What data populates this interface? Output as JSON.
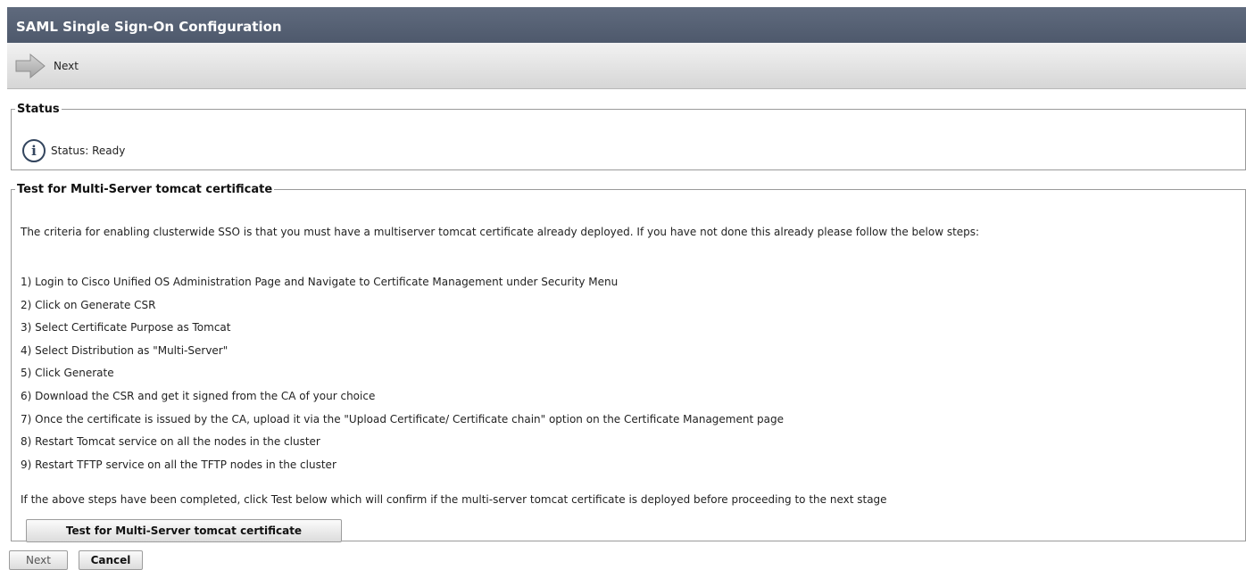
{
  "window": {
    "title": "SAML Single Sign-On Configuration"
  },
  "toolbar": {
    "next_label": "Next",
    "next_icon": "arrow-right-icon"
  },
  "status": {
    "legend": "Status",
    "icon": "info-icon",
    "icon_glyph": "i",
    "text": "Status: Ready"
  },
  "test_section": {
    "legend": "Test for Multi-Server tomcat certificate",
    "intro": "The criteria for enabling clusterwide SSO is that you must have a multiserver tomcat certificate already deployed. If you have not done this already please follow the below steps:",
    "steps": [
      "1) Login to Cisco Unified OS Administration Page and Navigate to Certificate Management under Security Menu",
      "2) Click on Generate CSR",
      "3) Select Certificate Purpose as Tomcat",
      "4) Select Distribution as \"Multi-Server\"",
      "5) Click Generate",
      "6) Download the CSR and get it signed from the CA of your choice",
      "7) Once the certificate is issued by the CA, upload it via the \"Upload Certificate/ Certificate chain\" option on the Certificate Management page",
      "8) Restart Tomcat service on all the nodes in the cluster",
      "9) Restart TFTP service on all the TFTP nodes in the cluster"
    ],
    "outro": "If the above steps have been completed, click Test below which will confirm if the multi-server tomcat certificate is deployed before proceeding to the next stage",
    "test_button_label": "Test for Multi-Server tomcat certificate"
  },
  "footer": {
    "next_label": "Next",
    "cancel_label": "Cancel"
  }
}
